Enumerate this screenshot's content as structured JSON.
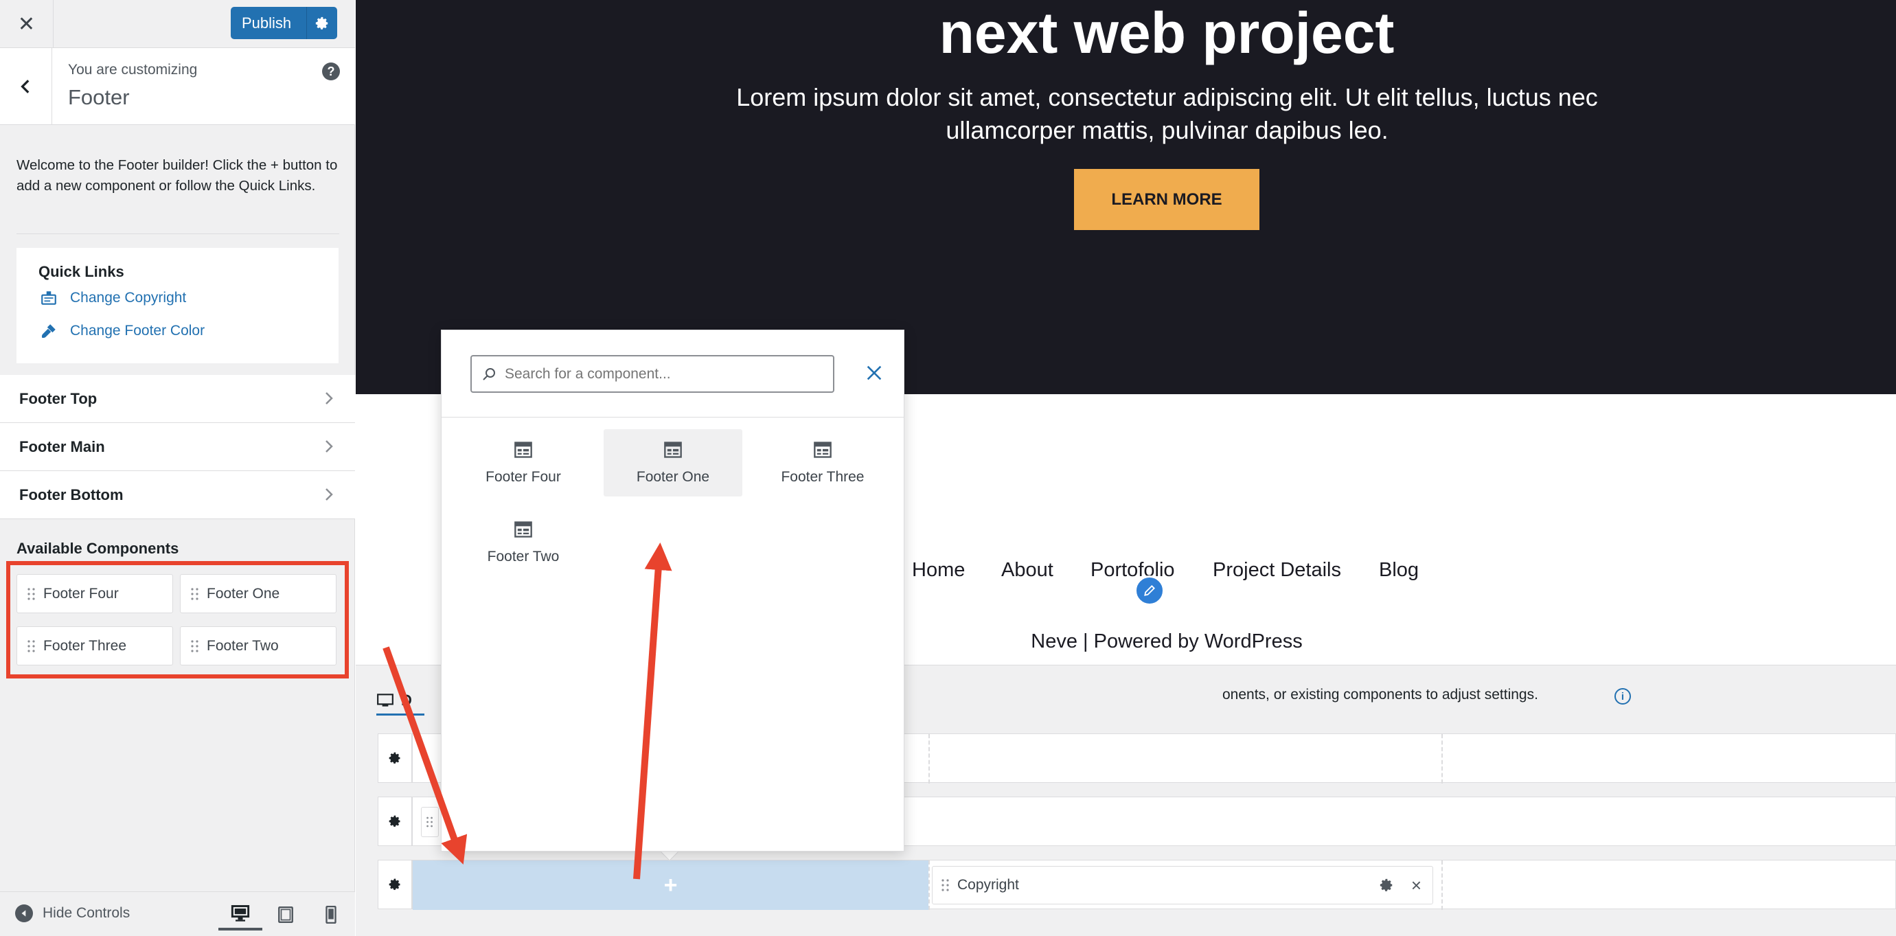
{
  "colors": {
    "accent": "#2271b1",
    "hero_bg": "#1a1a22",
    "cta": "#f0ac4e",
    "highlight_box": "#e8432d",
    "active_slot": "#c7dcef"
  },
  "sidebar": {
    "publish_label": "Publish",
    "customizing_label": "You are customizing",
    "panel_title": "Footer",
    "welcome_text": "Welcome to the Footer builder! Click the + button to add a new component or follow the Quick Links.",
    "quick_links": {
      "title": "Quick Links",
      "links": [
        {
          "label": "Change Copyright",
          "icon": "copyright-icon"
        },
        {
          "label": "Change Footer Color",
          "icon": "paint-brush-icon"
        }
      ]
    },
    "sections": [
      {
        "label": "Footer Top"
      },
      {
        "label": "Footer Main"
      },
      {
        "label": "Footer Bottom"
      }
    ],
    "available_components": {
      "title": "Available Components",
      "items": [
        "Footer Four",
        "Footer One",
        "Footer Three",
        "Footer Two"
      ]
    },
    "hide_controls_label": "Hide Controls",
    "device_buttons": [
      "desktop-icon",
      "tablet-icon",
      "mobile-icon"
    ]
  },
  "preview": {
    "hero_title": "next web project",
    "hero_subtitle": "Lorem ipsum dolor sit amet, consectetur adipiscing elit. Ut elit tellus, luctus nec ullamcorper mattis, pulvinar dapibus leo.",
    "cta_label": "LEARN MORE",
    "nav": [
      "Home",
      "About",
      "Portofolio",
      "Project Details",
      "Blog"
    ],
    "powered_by": "Neve | Powered by WordPress"
  },
  "builder": {
    "tab_label": "D",
    "hint": "onents, or existing components to adjust settings.",
    "copyright_chip": "Copyright",
    "add_symbol": "+"
  },
  "popover": {
    "search_placeholder": "Search for a component...",
    "items": [
      "Footer Four",
      "Footer One",
      "Footer Three",
      "Footer Two"
    ]
  }
}
